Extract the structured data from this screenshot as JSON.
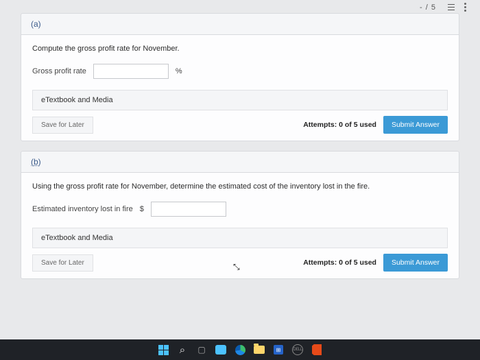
{
  "topbar": {
    "score": "- / 5"
  },
  "partA": {
    "label": "(a)",
    "question": "Compute the gross profit rate for November.",
    "field_label": "Gross profit rate",
    "unit": "%",
    "etext": "eTextbook and Media",
    "save": "Save for Later",
    "attempts": "Attempts: 0 of 5 used",
    "submit": "Submit Answer"
  },
  "partB": {
    "label": "(b)",
    "question": "Using the gross profit rate for November, determine the estimated cost of the inventory lost in the fire.",
    "field_label": "Estimated inventory lost in fire",
    "currency": "$",
    "etext": "eTextbook and Media",
    "save": "Save for Later",
    "attempts": "Attempts: 0 of 5 used",
    "submit": "Submit Answer"
  },
  "taskbar": {
    "store_glyph": "⊞",
    "dell": "DELL"
  }
}
